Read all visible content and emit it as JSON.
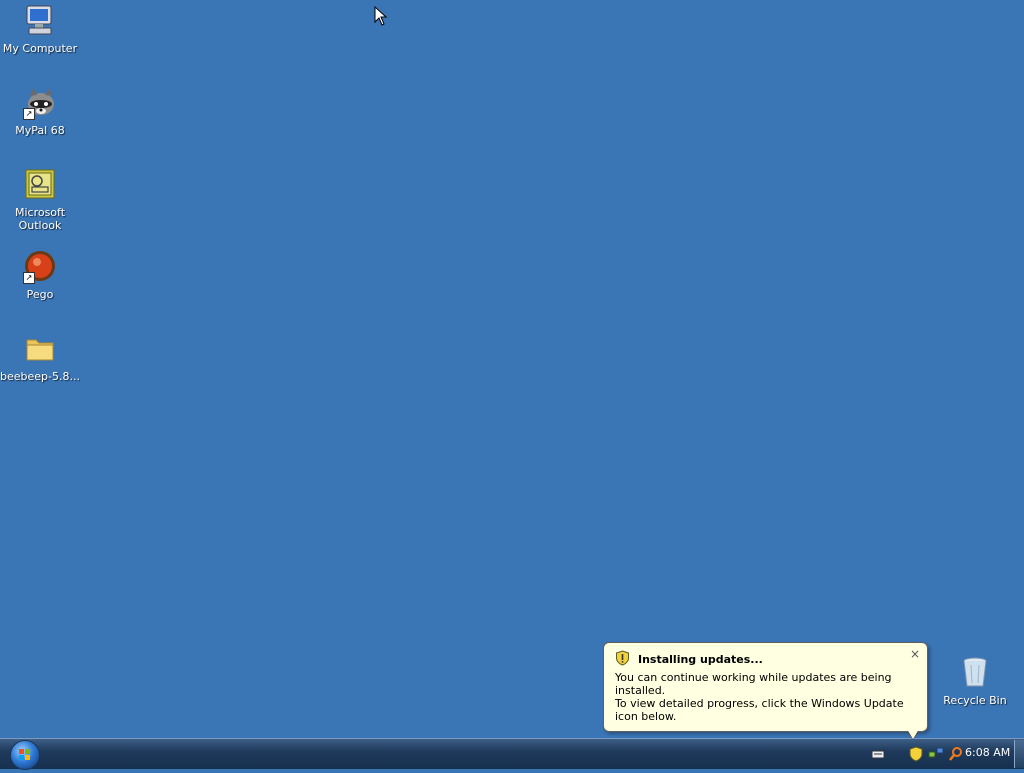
{
  "desktop": {
    "icons": [
      {
        "label": "My Computer"
      },
      {
        "label": "MyPal 68"
      },
      {
        "label": "Microsoft Outlook"
      },
      {
        "label": "Pego"
      },
      {
        "label": "beebeep-5.8..."
      },
      {
        "label": "Recycle Bin"
      }
    ]
  },
  "notification": {
    "title": "Installing updates...",
    "line1": "You can continue working while updates are being installed.",
    "line2": "To view detailed progress, click the Windows Update icon below.",
    "close_label": "×"
  },
  "taskbar": {
    "clock": "6:08 AM"
  },
  "colors": {
    "desktop_bg": "#3a75b6",
    "balloon_bg": "#ffffe1",
    "taskbar": "#17304f"
  }
}
